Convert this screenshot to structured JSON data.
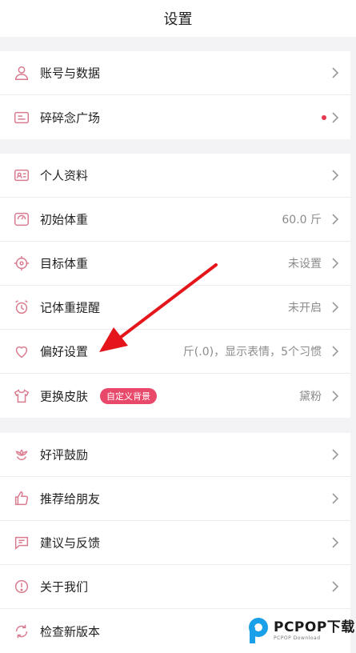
{
  "header": {
    "title": "设置"
  },
  "groups": [
    {
      "items": [
        {
          "label": "账号与数据",
          "icon": "user-icon",
          "value": ""
        },
        {
          "label": "碎碎念广场",
          "icon": "message-board-icon",
          "value": "",
          "dot": true
        }
      ]
    },
    {
      "items": [
        {
          "label": "个人资料",
          "icon": "id-card-icon",
          "value": ""
        },
        {
          "label": "初始体重",
          "icon": "scale-icon",
          "value": "60.0 斤"
        },
        {
          "label": "目标体重",
          "icon": "target-icon",
          "value": "未设置"
        },
        {
          "label": "记体重提醒",
          "icon": "alarm-clock-icon",
          "value": "未开启"
        },
        {
          "label": "偏好设置",
          "icon": "heart-icon",
          "value": "斤(.0)，显示表情，5个习惯"
        },
        {
          "label": "更换皮肤",
          "icon": "tshirt-icon",
          "value": "黛粉",
          "badge": "自定义背景"
        }
      ]
    },
    {
      "items": [
        {
          "label": "好评鼓励",
          "icon": "flower-icon",
          "value": ""
        },
        {
          "label": "推荐给朋友",
          "icon": "thumbs-up-icon",
          "value": ""
        },
        {
          "label": "建议与反馈",
          "icon": "chat-icon",
          "value": ""
        },
        {
          "label": "关于我们",
          "icon": "info-icon",
          "value": ""
        },
        {
          "label": "检查新版本",
          "icon": "refresh-icon",
          "value": ""
        }
      ]
    }
  ],
  "watermark": {
    "main": "PCPOP下载",
    "sub": "PCPOP Download"
  },
  "colors": {
    "accent": "#e8496a",
    "icon": "#d97a8e",
    "arrow": "#e4161b"
  }
}
